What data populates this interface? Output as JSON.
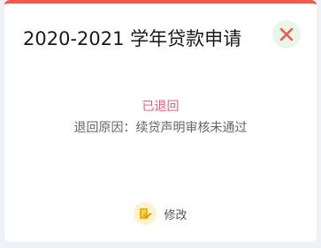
{
  "dialog": {
    "title": "2020-2021 学年贷款申请",
    "close_icon": "close-icon",
    "status": "已退回",
    "reason": "退回原因：续贷声明审核未通过",
    "edit": {
      "icon": "edit-icon",
      "label": "修改"
    }
  },
  "colors": {
    "accent_bar": "#ef5a4d",
    "status_text": "#e0607a",
    "close_bg": "#e8f6ea",
    "close_x": "#ef5a4d",
    "edit_icon_bg": "#fdf3cf",
    "edit_icon": "#f0b400"
  }
}
